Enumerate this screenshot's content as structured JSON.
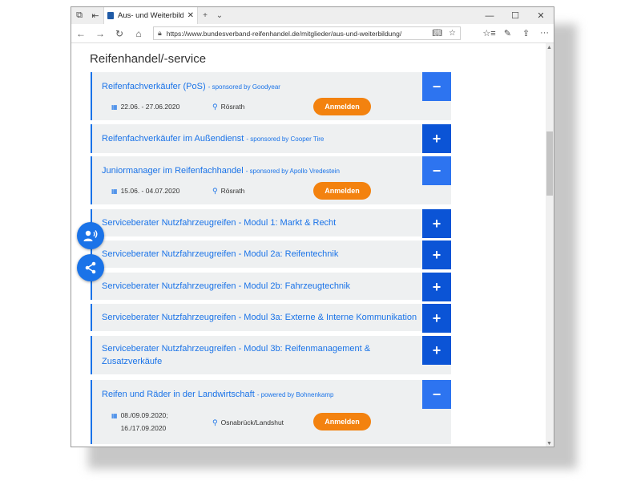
{
  "browser": {
    "tab_title": "Aus- und Weiterbildung",
    "url": "https://www.bundesverband-reifenhandel.de/mitglieder/aus-und-weiterbildung/"
  },
  "page": {
    "section_title": "Reifenhandel/-service",
    "register_label": "Anmelden",
    "items": [
      {
        "title": "Reifenfachverkäufer (PoS)",
        "sponsor": "- sponsored by Goodyear",
        "date": "22.06. - 27.06.2020",
        "location": "Rösrath",
        "expanded": true
      },
      {
        "title": "Reifenfachverkäufer im Außendienst",
        "sponsor": "- sponsored by Cooper Tire",
        "expanded": false
      },
      {
        "title": "Juniormanager im Reifenfachhandel",
        "sponsor": "- sponsored by Apollo Vredestein",
        "date": "15.06. - 04.07.2020",
        "location": "Rösrath",
        "expanded": true
      },
      {
        "title": "Serviceberater Nutzfahrzeugreifen - Modul 1: Markt & Recht",
        "expanded": false
      },
      {
        "title": "Serviceberater Nutzfahrzeugreifen - Modul 2a: Reifentechnik",
        "expanded": false
      },
      {
        "title": "Serviceberater Nutzfahrzeugreifen - Modul 2b: Fahrzeugtechnik",
        "expanded": false
      },
      {
        "title": "Serviceberater Nutzfahrzeugreifen - Modul 3a: Externe & Interne Kommunikation",
        "expanded": false
      },
      {
        "title": "Serviceberater Nutzfahrzeugreifen - Modul 3b: Reifenmanagement & Zusatzverkäufe",
        "expanded": false
      },
      {
        "title": "Reifen und Räder in der Landwirtschaft",
        "sponsor": "- powered by Bohnenkamp",
        "date_line1": "08./09.09.2020;",
        "date_line2": "16./17.09.2020",
        "location": "Osnabrück/Landshut",
        "expanded": true
      }
    ]
  },
  "icons": {
    "expand": "+",
    "collapse": "−"
  },
  "colors": {
    "accent_blue": "#1a73e8",
    "toggle_blue": "#0b54d6",
    "register_orange": "#f3820f",
    "item_bg": "#eef0f1"
  }
}
